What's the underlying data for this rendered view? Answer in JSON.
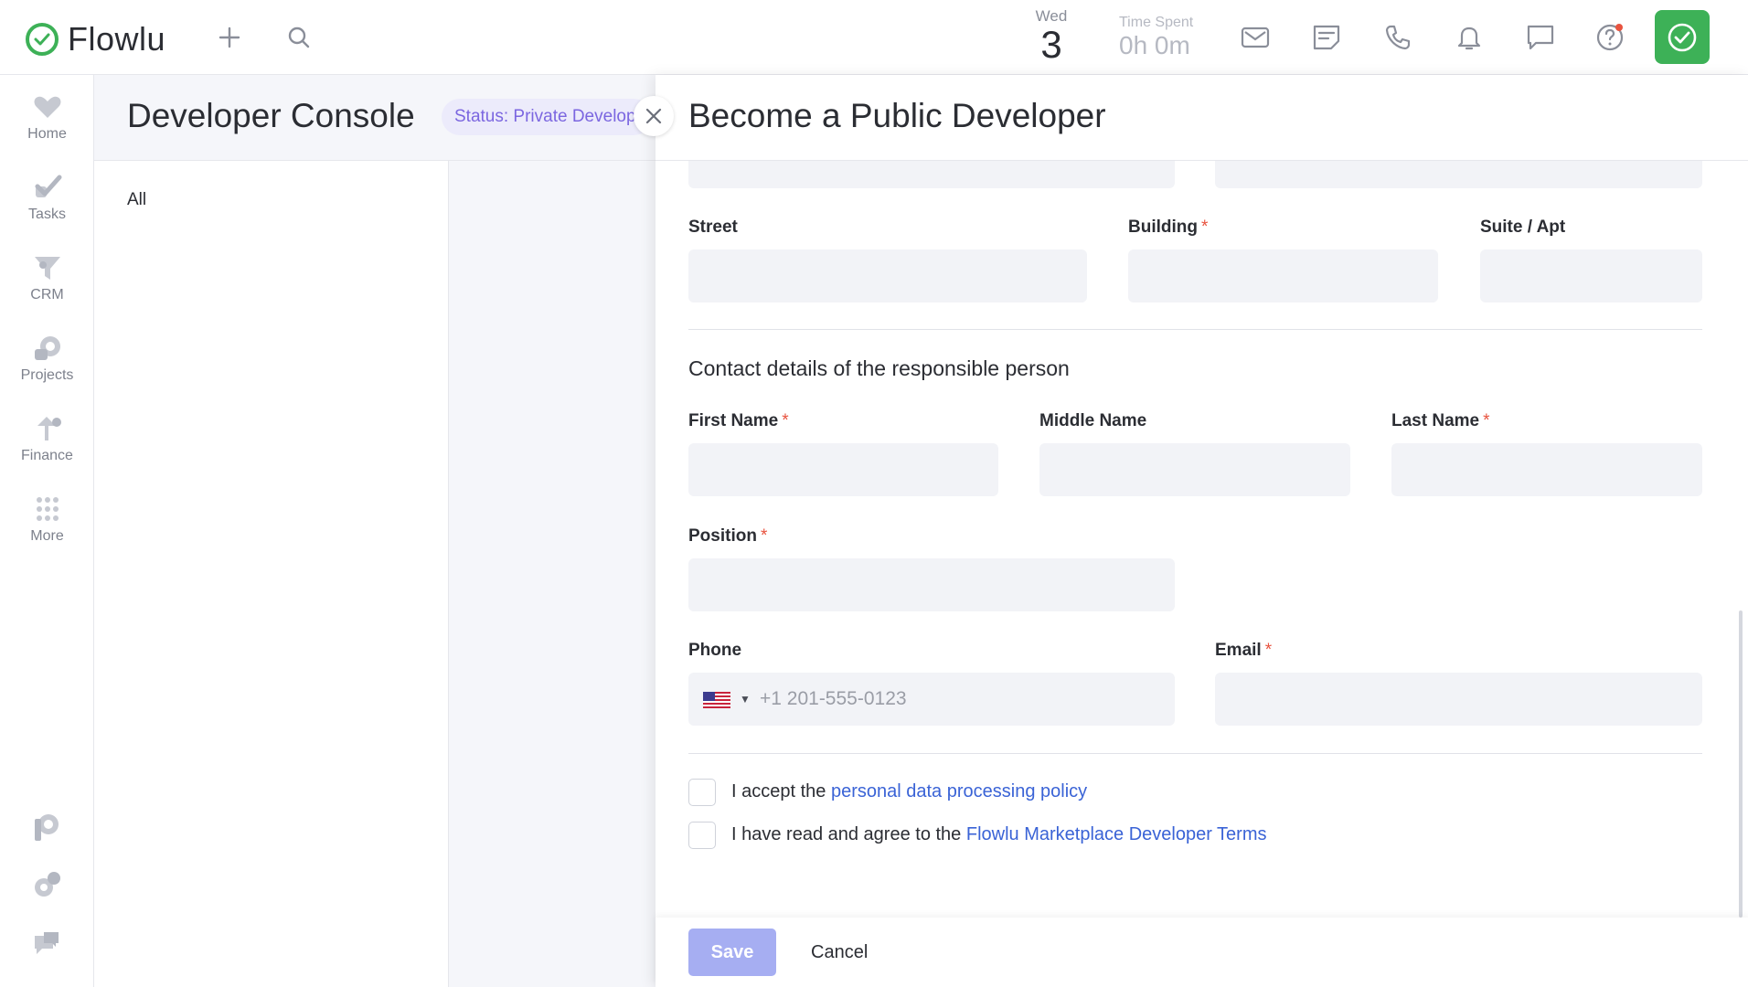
{
  "app": {
    "name": "Flowlu",
    "date": {
      "weekday": "Wed",
      "day": "3"
    },
    "time_spent": {
      "label": "Time Spent",
      "value": "0h 0m"
    }
  },
  "topbar": {
    "icons": [
      "plus-icon",
      "search-icon",
      "mail-icon",
      "note-icon",
      "phone-icon",
      "bell-icon",
      "chat-icon",
      "help-icon",
      "check-icon"
    ]
  },
  "sidebar": {
    "items": [
      {
        "label": "Home",
        "icon": "heart-icon"
      },
      {
        "label": "Tasks",
        "icon": "task-check-icon"
      },
      {
        "label": "CRM",
        "icon": "funnel-icon"
      },
      {
        "label": "Projects",
        "icon": "projects-icon"
      },
      {
        "label": "Finance",
        "icon": "finance-arrow-icon"
      },
      {
        "label": "More",
        "icon": "grid-dots-icon"
      }
    ],
    "bottom_icons": [
      "p-logo-icon",
      "settings-gear-icon",
      "support-chat-icon"
    ]
  },
  "page": {
    "title": "Developer Console",
    "status": "Status: Private Developer",
    "filter_all": "All"
  },
  "modal": {
    "title": "Become a Public Developer",
    "address": {
      "street_label": "Street",
      "building_label": "Building",
      "suite_label": "Suite / Apt",
      "street_value": "",
      "building_value": "",
      "suite_value": ""
    },
    "contact": {
      "section_title": "Contact details of the responsible person",
      "first_name_label": "First Name",
      "middle_name_label": "Middle Name",
      "last_name_label": "Last Name",
      "position_label": "Position",
      "phone_label": "Phone",
      "phone_placeholder": "+1 201-555-0123",
      "email_label": "Email",
      "required_mark": "*"
    },
    "consent": {
      "policy_prefix": "I accept the ",
      "policy_link": "personal data processing policy",
      "terms_prefix": "I have read and agree to the ",
      "terms_link": "Flowlu Marketplace Developer Terms"
    },
    "footer": {
      "save": "Save",
      "cancel": "Cancel"
    }
  },
  "colors": {
    "brand_green": "#3db157",
    "status_purple": "#7b66e0",
    "link_blue": "#3a63d6",
    "save_disabled": "#a6aef2",
    "required_red": "#e8533f"
  }
}
